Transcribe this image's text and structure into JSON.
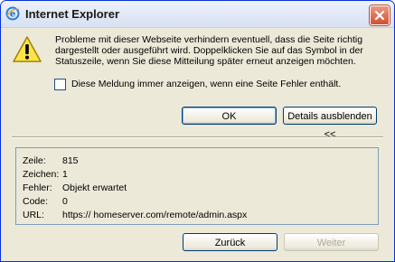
{
  "window": {
    "title": "Internet Explorer"
  },
  "message": {
    "line1": "Probleme mit dieser Webseite verhindern eventuell, dass die Seite richtig",
    "line2": "dargestellt oder ausgeführt wird. Doppelklicken Sie auf das Symbol in der",
    "line3": "Statuszeile, wenn Sie diese Mitteilung später erneut anzeigen möchten."
  },
  "checkbox": {
    "label": "Diese Meldung immer anzeigen, wenn eine Seite Fehler enthält.",
    "checked": false
  },
  "buttons": {
    "ok": "OK",
    "details": "Details ausblenden <<",
    "back": "Zurück",
    "next": "Weiter"
  },
  "details": {
    "rows": [
      {
        "key": "Zeile:",
        "value": "815"
      },
      {
        "key": "Zeichen:",
        "value": "1"
      },
      {
        "key": "Fehler:",
        "value": "Objekt erwartet"
      },
      {
        "key": "Code:",
        "value": "0"
      },
      {
        "key": "URL:",
        "value": "https://              homeserver.com/remote/admin.aspx"
      }
    ]
  },
  "icons": {
    "title": "ie-logo-icon",
    "warning": "warning-icon",
    "close": "close-icon"
  }
}
